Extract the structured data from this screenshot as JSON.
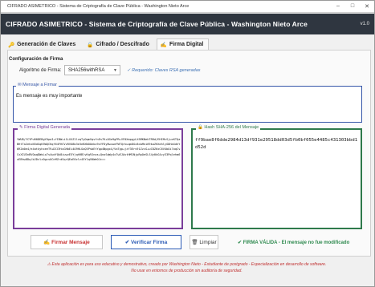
{
  "window": {
    "title": "CIFRADO ASIMETRICO - Sistema de Criptografía de Clave Pública - Washington Nieto Arce",
    "controls": [
      "minimize-icon",
      "maximize-icon",
      "close-icon"
    ]
  },
  "header": {
    "title": "CIFRADO ASIMETRICO - Sistema de Criptografía de Clave Pública - Washington Nieto Arce",
    "version": "v1.0"
  },
  "tabs": [
    {
      "label": "Generación de Claves",
      "icon": "key-icon"
    },
    {
      "label": "Cifrado / Descifrado",
      "icon": "lock-icon"
    },
    {
      "label": "Firma Digital",
      "icon": "pen-icon",
      "active": true
    }
  ],
  "config": {
    "title": "Configuración de Firma",
    "algorithm_label": "Algoritmo de Firma:",
    "algorithm_value": "SHA256withRSA",
    "requirement": "✓ Requerido: Claves RSA generadas"
  },
  "message": {
    "label": "✉ Mensaje a Firmar",
    "value": "Es mensaje es muy importante"
  },
  "signature": {
    "label": "✎ Firma Digital Generada",
    "value": "YWUB/YCYPuR0DEBgYOpaI+fIBW+i1LXXZ1lvqTyOqmSqvfnEs7K+OGe9gPR+VF0Xmp9yLXSMKNekTRRd/EHiMcSjuzKTQaBHtTa2ehxN3dGqK5WQCKqf64FHCVzRVO8b3e3eBXWOOebv9sYFDyBwvweFWTQrkuqmDGc8duMei69kaZHXdhlyGDHaXdhY6R2b0e4/e4atkyhxeeT9+DCCRtuGHbEi4O9HLGoQ5PsbEtYpp4NpgxX/VaTgp+jzY3Erv91ZzcG+uC8Z6xC6V4bOi7oqCvCxXIU3nBVOwqDWoLo7s4udfQk8iuwvE5YjqhRBlvKq9Jnos+QnoSqWy4xTwEJAvtHM1NjpRpOeSLS4y0kG4zy33Pqlehm6xEBhw8Dw/bJDvlz0gcsUCnMZrdSqrQEoE0zlz45Y1qV0WeOJc==",
    "display": "YWUB/YCYPuR0DEBgYOpaI+fIBW+i1LXXZ1lvqTyOqmSqvfnEs7K+OGe9gPR+VF0XmpgyLXSMKNekTRRd/EHIMcSjuzKTQaBHtTa2ehxN3dGqK5WQCKqf64FHCVzRVO8b3e3eBXWOOebv9sYFDyBwvweFWTQrkuqmDGc8duMei69kaZHXdhlyGDHaXdhY6R2b0e4/e4atkyhxeeT9+DCCRtuGHbEi4O9HLGoQ5PsbEtYpp4NpgxX/VaTgp+jzY3Erv91ZzcG+uC8Z6xC6V4bOi7oqCvCxXIU3nBVOwqDWoLo7s4udfQk8iuwvE5YjqhRBlvKq9Jnos+QnoSqWy4xTwEJAvtHM1NjpRpOeSLS4y0kG4zy33Pqlehm6xEBhw8Dw/bJDvlz0gcsUCnMZrdSqrQEoE0zlz45Y1qV0WeOJc=="
  },
  "hash": {
    "label": "🔒 Hash SHA-256 del Mensaje",
    "value": "ff9bae8f6dde2984d13df931e29518dd03d5fb0bf055e4485c431303bbd1d52d"
  },
  "buttons": {
    "sign": "✍ Firmar Mensaje",
    "verify": "✔ Verificar Firma",
    "clear": "🗑 Limpiar"
  },
  "status": "✔ FIRMA VÁLIDA - El mensaje no fue modificado",
  "footer": {
    "line1": "⚠ Esta aplicación es para uso educativo y demostrativo, creado por Washington Nieto - Estudiante de postgrado - Especialización en desarrollo de software.",
    "line2": "No usar en entornos de producción sin auditoría de seguridad."
  },
  "colors": {
    "header_bg": "#2f3640",
    "message_border": "#3556a8",
    "signature_border": "#7a3e9a",
    "hash_border": "#2f7a4c",
    "sign_text": "#c83232",
    "verify_text": "#2a5ab5",
    "status_text": "#2f8a4f",
    "footer_text": "#c03030"
  }
}
